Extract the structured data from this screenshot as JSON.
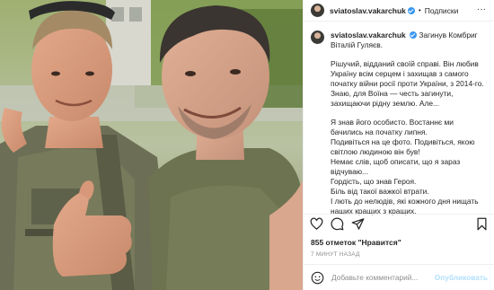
{
  "post": {
    "username": "sviatoslav.vakarchuk",
    "verified_icon": "verified-badge-icon",
    "header_separator": "•",
    "follow_label": "Подписки",
    "more_label": "···"
  },
  "photo": {
    "description_icon": "photo"
  },
  "caption": {
    "username": "sviatoslav.vakarchuk",
    "intro": "Загинув Комбриг Віталій Гуляєв.",
    "paragraphs": [
      "Рішучий, відданий своїй справі. Він любив Україну всім серцем і захищав з самого початку війни росії проти України, з 2014-го.\nЗнаю, для Воїна — честь загинути, захищаючи рідну землю. Але...",
      "Я знав його особисто. Востаннє ми бачились на початку липня.\nПодивіться на це фото. Подивіться, якою світлою людиною він був!\nНемає слів, щоб описати, що я зараз відчуваю...\nГордість, що знав Героя.\nБіль від такої важкої втрати.\nІ лють до нелюдів, які кожного дня нищать наших кращих з кращих."
    ]
  },
  "actions": {
    "like_icon": "heart-icon",
    "comment_icon": "comment-icon",
    "share_icon": "share-icon",
    "save_icon": "bookmark-icon"
  },
  "stats": {
    "likes_text": "855 отметок \"Нравится\"",
    "time_text": "7 минут назад"
  },
  "comment_box": {
    "emoji_icon": "smiley-icon",
    "placeholder": "Добавьте комментарий...",
    "publish_label": "Опубликовать"
  },
  "colors": {
    "accent": "#3897f0",
    "publish_disabled": "#b2dffc",
    "muted_text": "#8e8e8e",
    "border": "#efefef"
  }
}
